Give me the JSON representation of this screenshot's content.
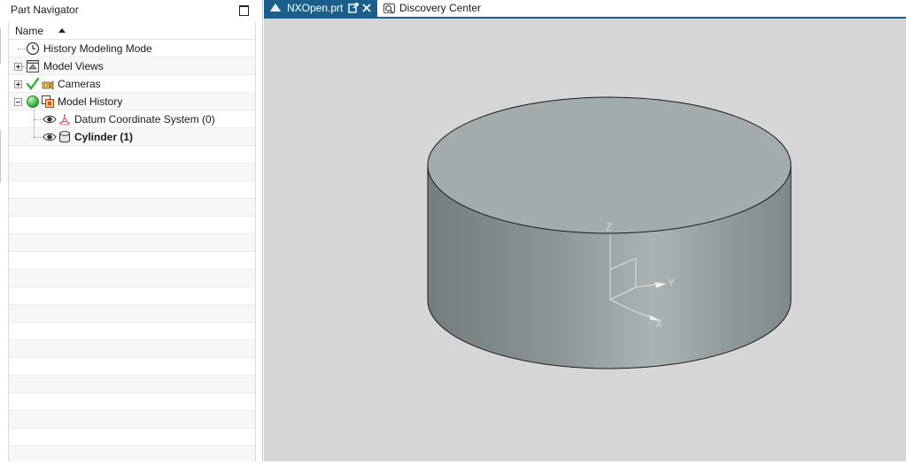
{
  "navigator": {
    "title": "Part Navigator",
    "column_header": "Name",
    "rows": [
      {
        "label": "History Modeling Mode",
        "icon": "clock-icon",
        "bold": false
      },
      {
        "label": "Model Views",
        "icon": "model-views-icon",
        "bold": false
      },
      {
        "label": "Cameras",
        "icon": "camera-icon",
        "bold": false
      },
      {
        "label": "Model History",
        "icon": "model-history-icon",
        "bold": false
      },
      {
        "label": "Datum Coordinate System (0)",
        "icon": "datum-csys-icon",
        "bold": false
      },
      {
        "label": "Cylinder (1)",
        "icon": "cylinder-icon",
        "bold": true
      }
    ]
  },
  "tabs": [
    {
      "label": "NXOpen.prt",
      "active": true,
      "icon": "part-file-icon"
    },
    {
      "label": "Discovery Center",
      "active": false,
      "icon": "discovery-center-icon"
    }
  ],
  "viewport": {
    "background": "#d6d6d6",
    "axis_labels": {
      "z": "Z",
      "y": "Y",
      "x": "X"
    }
  },
  "colors": {
    "accent": "#1a5f8c",
    "check": "#2db52d",
    "status_green": "#22b14c"
  }
}
